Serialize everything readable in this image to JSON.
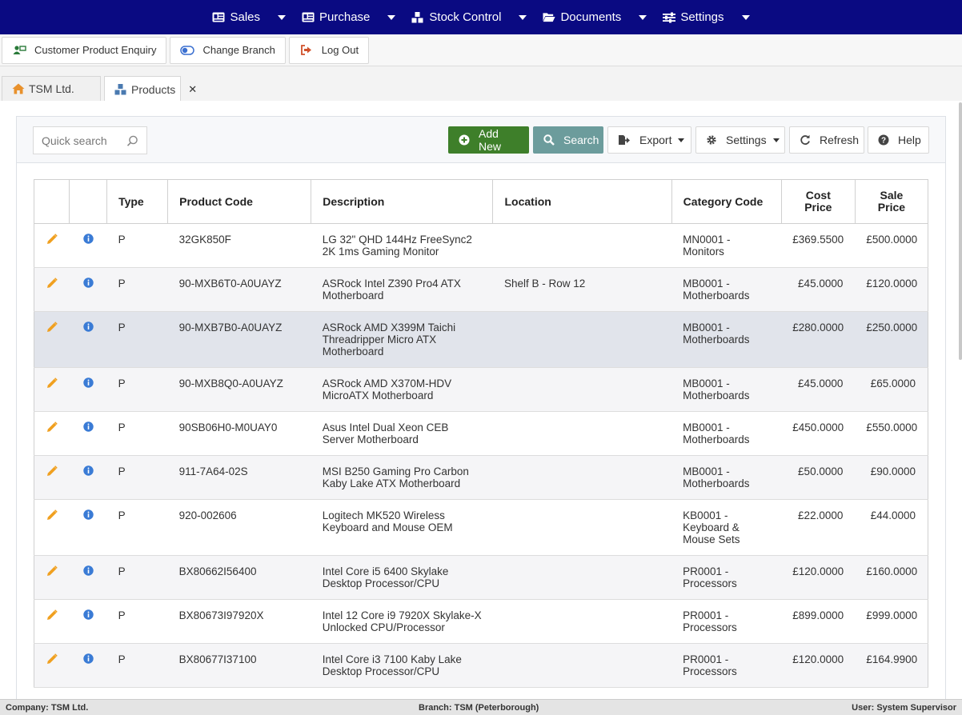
{
  "nav": {
    "items": [
      {
        "label": "Sales",
        "icon": "id-card-icon"
      },
      {
        "label": "Purchase",
        "icon": "id-card-icon"
      },
      {
        "label": "Stock Control",
        "icon": "boxes-icon"
      },
      {
        "label": "Documents",
        "icon": "folder-open-icon"
      },
      {
        "label": "Settings",
        "icon": "sliders-icon"
      }
    ]
  },
  "toolbar": {
    "customer_enquiry": "Customer Product Enquiry",
    "change_branch": "Change Branch",
    "log_out": "Log Out"
  },
  "tabs": {
    "home": "TSM Ltd.",
    "products": "Products",
    "close": "✕"
  },
  "header": {
    "search_placeholder": "Quick search",
    "add_new": "Add New",
    "search": "Search",
    "export": "Export",
    "settings": "Settings",
    "refresh": "Refresh",
    "help": "Help"
  },
  "table": {
    "columns": [
      "Type",
      "Product Code",
      "Description",
      "Location",
      "Category Code",
      "Cost Price",
      "Sale Price"
    ],
    "rows": [
      {
        "type": "P",
        "code": "32GK850F",
        "description": "LG 32\" QHD 144Hz FreeSync2 2K 1ms Gaming Monitor",
        "location": "",
        "category": "MN0001 - Monitors",
        "cost": "£369.5500",
        "sale": "£500.0000"
      },
      {
        "type": "P",
        "code": "90-MXB6T0-A0UAYZ",
        "description": "ASRock Intel Z390 Pro4 ATX Motherboard",
        "location": "Shelf B - Row 12",
        "category": "MB0001 - Motherboards",
        "cost": "£45.0000",
        "sale": "£120.0000"
      },
      {
        "type": "P",
        "code": "90-MXB7B0-A0UAYZ",
        "description": "ASRock AMD X399M Taichi Threadripper Micro ATX Motherboard",
        "location": "",
        "category": "MB0001 - Motherboards",
        "cost": "£280.0000",
        "sale": "£250.0000"
      },
      {
        "type": "P",
        "code": "90-MXB8Q0-A0UAYZ",
        "description": "ASRock AMD X370M-HDV MicroATX Motherboard",
        "location": "",
        "category": "MB0001 - Motherboards",
        "cost": "£45.0000",
        "sale": "£65.0000"
      },
      {
        "type": "P",
        "code": "90SB06H0-M0UAY0",
        "description": "Asus Intel Dual Xeon CEB Server Motherboard",
        "location": "",
        "category": "MB0001 - Motherboards",
        "cost": "£450.0000",
        "sale": "£550.0000"
      },
      {
        "type": "P",
        "code": "911-7A64-02S",
        "description": "MSI B250 Gaming Pro Carbon Kaby Lake ATX Motherboard",
        "location": "",
        "category": "MB0001 - Motherboards",
        "cost": "£50.0000",
        "sale": "£90.0000"
      },
      {
        "type": "P",
        "code": "920-002606",
        "description": "Logitech MK520 Wireless Keyboard and Mouse OEM",
        "location": "",
        "category": "KB0001 - Keyboard & Mouse Sets",
        "cost": "£22.0000",
        "sale": "£44.0000"
      },
      {
        "type": "P",
        "code": "BX80662I56400",
        "description": "Intel Core i5 6400 Skylake Desktop Processor/CPU",
        "location": "",
        "category": "PR0001 - Processors",
        "cost": "£120.0000",
        "sale": "£160.0000"
      },
      {
        "type": "P",
        "code": "BX80673I97920X",
        "description": "Intel 12 Core i9 7920X Skylake-X Unlocked CPU/Processor",
        "location": "",
        "category": "PR0001 - Processors",
        "cost": "£899.0000",
        "sale": "£999.0000"
      },
      {
        "type": "P",
        "code": "BX80677I37100",
        "description": "Intel Core i3 7100 Kaby Lake Desktop Processor/CPU",
        "location": "",
        "category": "PR0001 - Processors",
        "cost": "£120.0000",
        "sale": "£164.9900"
      }
    ],
    "selected_row": 2
  },
  "status": {
    "company": "Company: TSM Ltd.",
    "branch": "Branch: TSM (Peterborough)",
    "user": "User: System Supervisor"
  },
  "colors": {
    "nav_bg": "#0a0a82",
    "add_new": "#3e7f2a",
    "search_btn": "#6c9c9c",
    "edit_icon": "#f0a020",
    "info_icon": "#3a7bd5"
  }
}
